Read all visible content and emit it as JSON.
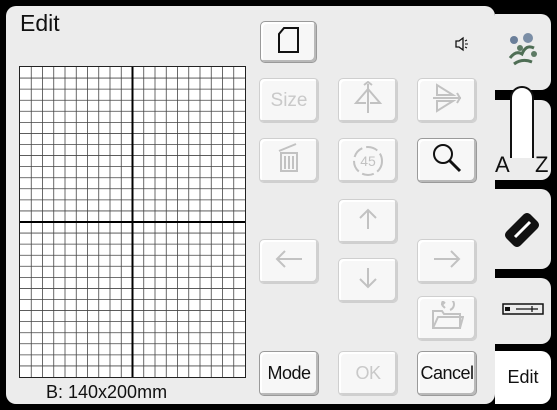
{
  "screen": {
    "title": "Edit"
  },
  "canvas": {
    "size_label": "B: 140x200mm"
  },
  "toolbar": {
    "size_label": "Size",
    "mode_label": "Mode",
    "ok_label": "OK",
    "cancel_label": "Cancel",
    "rotate_label": "45"
  },
  "tabs": {
    "letters_left": "A",
    "letters_right": "Z",
    "edit_label": "Edit"
  },
  "icons": {
    "frame": "frame-icon",
    "speaker": "speaker-icon",
    "mirror": "mirror-icon",
    "flip": "flip-icon",
    "delete": "trash-icon",
    "rotate": "rotate-icon",
    "zoom": "magnifier-icon",
    "arrow_up": "arrow-up-icon",
    "arrow_down": "arrow-down-icon",
    "arrow_left": "arrow-left-icon",
    "arrow_right": "arrow-right-icon",
    "folder": "folder-open-icon",
    "embroidery": "embroidery-pattern-icon",
    "eraser": "eraser-icon",
    "usb": "usb-icon"
  },
  "colors": {
    "background": "#000000",
    "panel": "#ececec",
    "disabled": "#c9c9c9"
  }
}
